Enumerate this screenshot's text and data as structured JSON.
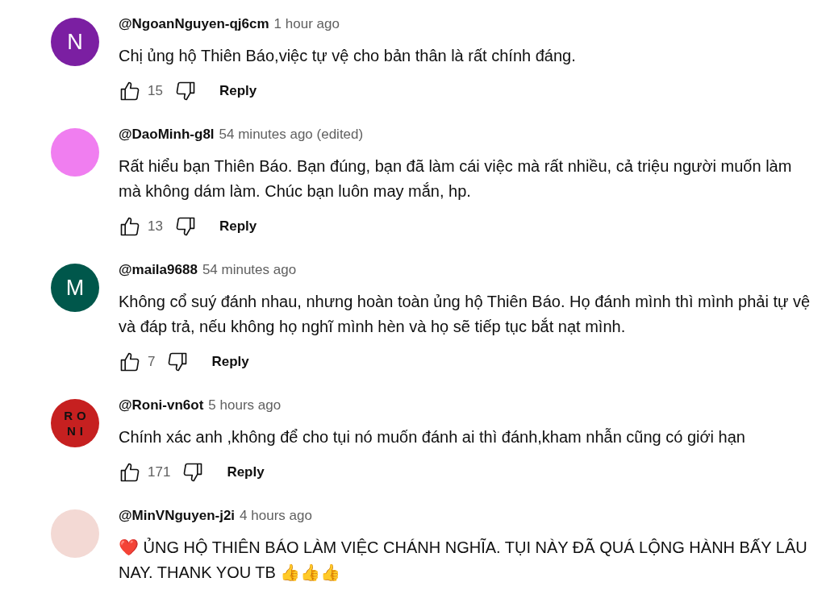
{
  "comments": [
    {
      "author": "@NgoanNguyen-qj6cm",
      "time": "1 hour ago",
      "text": "Chị ủng hộ Thiên Báo,việc tự vệ cho bản thân là rất chính đáng.",
      "likes": "15",
      "reply": "Reply",
      "avatar": {
        "kind": "letter",
        "lines": [
          "N"
        ],
        "color": "#7b1fa2"
      }
    },
    {
      "author": "@DaoMinh-g8l",
      "time": "54 minutes ago (edited)",
      "text": "Rất hiểu bạn Thiên Báo. Bạn đúng, bạn đã làm cái việc mà rất nhiều, cả triệu người muốn làm mà không dám làm. Chúc bạn luôn may mắn, hp.",
      "likes": "13",
      "reply": "Reply",
      "avatar": {
        "kind": "image",
        "color": "#f07ef0"
      }
    },
    {
      "author": "@maila9688",
      "time": "54 minutes ago",
      "text": "Không cổ suý đánh nhau, nhưng hoàn toàn ủng hộ Thiên Báo. Họ đánh mình thì mình phải tự vệ và đáp trả, nếu không họ nghĩ mình hèn và họ sẽ tiếp tục bắt nạt mình.",
      "likes": "7",
      "reply": "Reply",
      "avatar": {
        "kind": "letter",
        "lines": [
          "M"
        ],
        "color": "#00574b"
      }
    },
    {
      "author": "@Roni-vn6ot",
      "time": "5 hours ago",
      "text": "Chính xác anh ,không để cho tụi nó muốn đánh ai thì đánh,kham nhẫn cũng có giới hạn",
      "likes": "171",
      "reply": "Reply",
      "avatar": {
        "kind": "letter",
        "lines": [
          "RO",
          "NI"
        ],
        "color": "#c62020"
      }
    },
    {
      "author": "@MinVNguyen-j2i",
      "time": "4 hours ago",
      "text": "❤️ ỦNG HỘ THIÊN BÁO LÀM VIỆC CHÁNH NGHĨA. TỤI NÀY ĐÃ QUÁ LỘNG HÀNH BẤY LÂU NAY. THANK YOU TB 👍👍👍",
      "avatar": {
        "kind": "image",
        "color": "#f3d9d4"
      }
    }
  ]
}
